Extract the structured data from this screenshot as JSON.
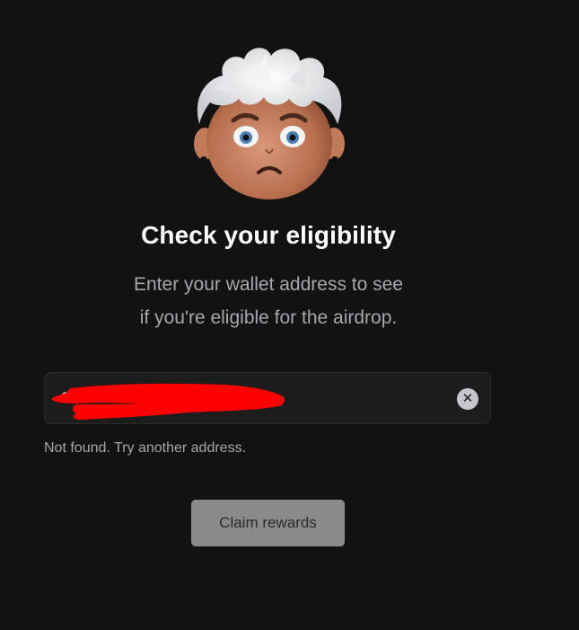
{
  "header": {
    "title": "Check your eligibility",
    "subtitle_line1": "Enter your wallet address to see",
    "subtitle_line2": "if you're eligible for the airdrop."
  },
  "avatar": {
    "icon": "sad-character-avatar-icon"
  },
  "wallet_input": {
    "value": "0x",
    "clear_icon": "close-icon",
    "clear_glyph": "✕",
    "redacted": true
  },
  "status": {
    "error_message": "Not found. Try another address."
  },
  "actions": {
    "claim_label": "Claim rewards"
  },
  "colors": {
    "background": "#121213",
    "title": "#ffffff",
    "subtitle": "#a6a8b0",
    "button_bg": "#8a8a8c",
    "redaction": "#ff0000"
  }
}
